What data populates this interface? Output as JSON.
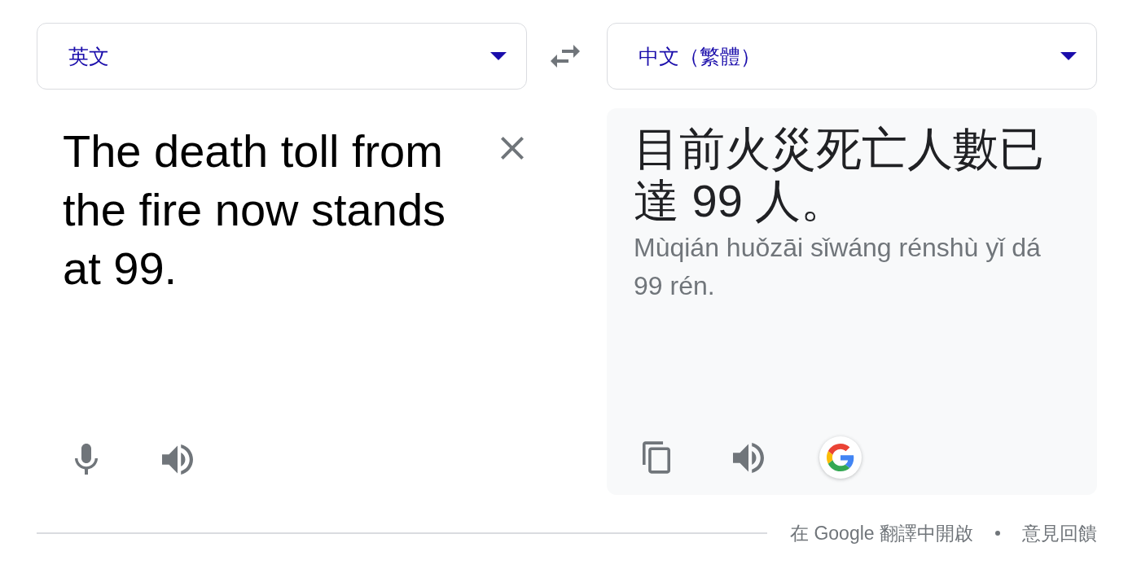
{
  "source": {
    "language": {
      "label": "英文"
    },
    "text": "The death toll from the fire now stands at 99."
  },
  "target": {
    "language": {
      "label": "中文（繁體）"
    },
    "text": "目前火災死亡人數已達 99 人。",
    "romanization": "Mùqián huǒzāi sǐwáng rénshù yǐ dá 99 rén."
  },
  "footer": {
    "links": [
      "在 Google 翻譯中開啟",
      "意見回饋"
    ]
  }
}
